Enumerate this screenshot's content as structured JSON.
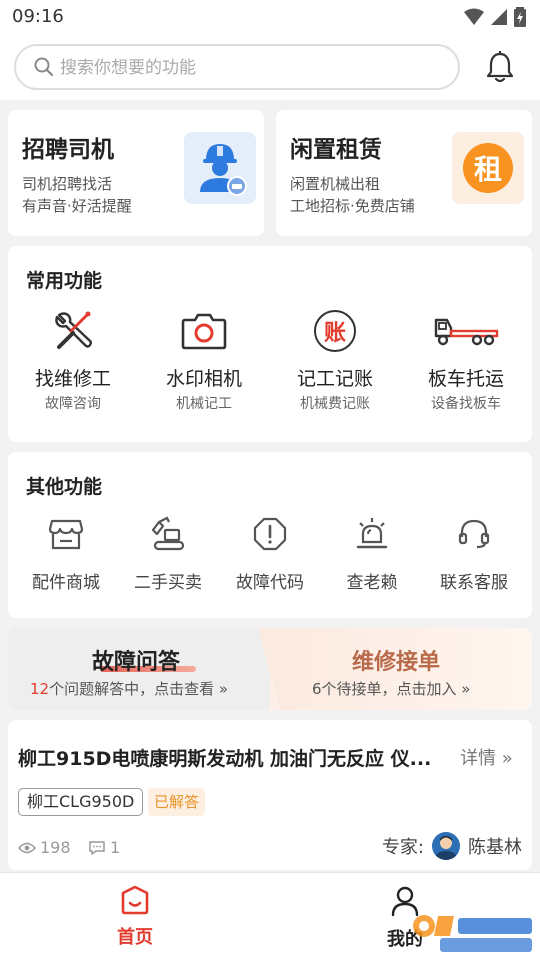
{
  "status_bar": {
    "time": "09:16"
  },
  "search": {
    "placeholder": "搜索你想要的功能"
  },
  "promo_cards": [
    {
      "title": "招聘司机",
      "line1": "司机招聘找活",
      "line2": "有声音·好活提醒",
      "icon": "driver-avatar-icon"
    },
    {
      "title": "闲置租赁",
      "line1": "闲置机械出租",
      "line2": "工地招标·免费店铺",
      "icon_text": "租"
    }
  ],
  "common_functions": {
    "title": "常用功能",
    "items": [
      {
        "name": "找维修工",
        "sub": "故障咨询",
        "icon": "wrench-screwdriver-icon"
      },
      {
        "name": "水印相机",
        "sub": "机械记工",
        "icon": "camera-icon"
      },
      {
        "name": "记工记账",
        "sub": "机械费记账",
        "icon_text": "账"
      },
      {
        "name": "板车托运",
        "sub": "设备找板车",
        "icon": "flatbed-truck-icon"
      }
    ]
  },
  "other_functions": {
    "title": "其他功能",
    "items": [
      {
        "name": "配件商城",
        "icon": "store-icon"
      },
      {
        "name": "二手买卖",
        "icon": "excavator-icon"
      },
      {
        "name": "故障代码",
        "icon": "warning-octagon-icon"
      },
      {
        "name": "查老赖",
        "icon": "alarm-siren-icon"
      },
      {
        "name": "联系客服",
        "icon": "headset-icon"
      }
    ]
  },
  "qa_banner": {
    "left": {
      "title": "故障问答",
      "count": "12",
      "desc": "个问题解答中，点击查看 »"
    },
    "right": {
      "title": "维修接单",
      "desc": "6个待接单，点击加入 »"
    }
  },
  "post": {
    "title": "柳工915D电喷康明斯发动机 加油门无反应  仪...",
    "detail": "详情 »",
    "tag": "柳工CLG950D",
    "badge": "已解答",
    "views": "198",
    "comments": "1",
    "expert_label": "专家:",
    "expert_name": "陈基林"
  },
  "tabbar": {
    "home": "首页",
    "mine": "我的"
  },
  "colors": {
    "accent": "#e23c2f",
    "orange": "#f7931e"
  }
}
